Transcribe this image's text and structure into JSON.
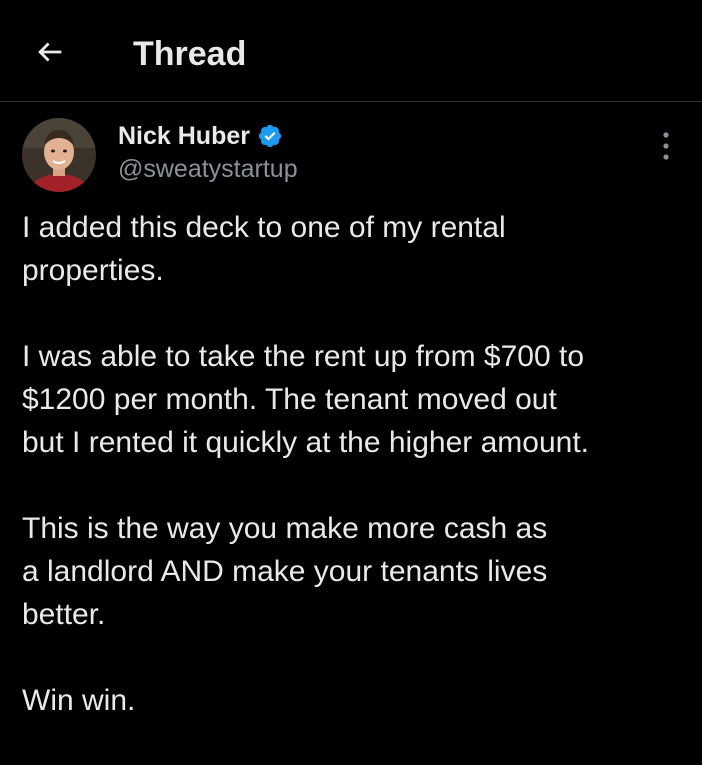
{
  "header": {
    "title": "Thread"
  },
  "tweet": {
    "author": {
      "name": "Nick Huber",
      "handle": "@sweatystartup",
      "verified": true
    },
    "paragraphs": [
      "I added this deck to one of my rental\nproperties.",
      "I was able to take the rent up from $700 to\n$1200 per month. The tenant moved out\nbut I rented it quickly at the higher amount.",
      "This is the way you make more cash as\na landlord AND make your tenants lives\nbetter.",
      "Win win."
    ]
  },
  "icons": {
    "back": "arrow-left-icon",
    "verified": "verified-badge-icon",
    "more": "more-vertical-icon"
  },
  "colors": {
    "background": "#000000",
    "text": "#e7e9ea",
    "secondary_text": "#8b9198",
    "verified_blue": "#1d9bf0",
    "divider": "#2f3336"
  }
}
